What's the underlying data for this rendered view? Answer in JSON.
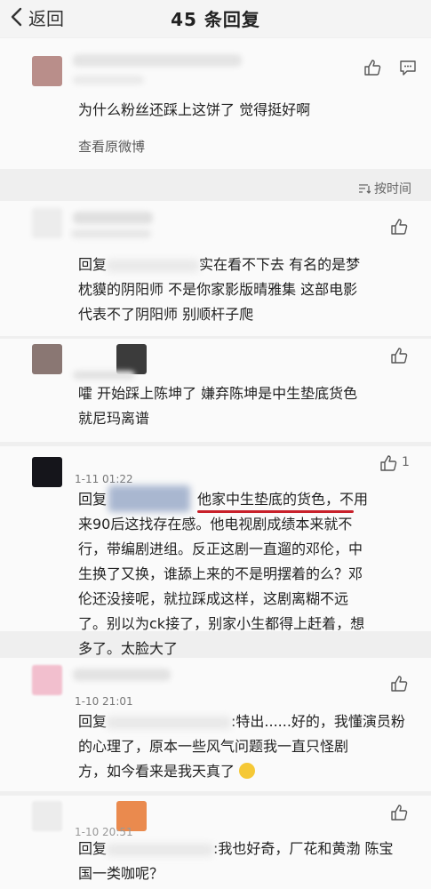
{
  "header": {
    "back_label": "返回",
    "title": "45 条回复"
  },
  "original": {
    "text": "为什么粉丝还踩上这饼了 觉得挺好啊",
    "view_original": "查看原微博"
  },
  "sort": {
    "label": "按时间"
  },
  "replies": [
    {
      "prefix": "回复",
      "line1": "实在看不下去 有名的是梦",
      "line2": "枕貘的阴阳师 不是你家影版晴雅集 这部电影",
      "line3": "代表不了阴阳师 别顺杆子爬"
    },
    {
      "line1": "嚯 开始踩上陈坤了 嫌弃陈坤是中生垫底货色",
      "line2": "就尼玛离谱"
    },
    {
      "time": "1-11 01:22",
      "likes": "1",
      "prefix": "回复",
      "highlight": "他家中生垫底的货色",
      "line1_rest": "，不用",
      "line2": "来90后这找存在感。他电视剧成绩本来就不",
      "line3": "行，带编剧进组。反正这剧一直遛的邓伦，中",
      "line4": "生换了又换，谁舔上来的不是明摆着的么？邓",
      "line5": "伦还没接呢，就拉踩成这样，这剧离糊不远",
      "line6": "了。别以为ck接了，别家小生都得上赶着，想",
      "line7": "多了。太脸大了"
    },
    {
      "time": "1-10 21:01",
      "prefix": "回复",
      "line1": ":特出......好的，我懂演员粉",
      "line2": "的心理了，原本一些风气问题我一直只怪剧",
      "line3": "方，如今看来是我天真了"
    },
    {
      "time": "1-10 20:51",
      "prefix": "回复",
      "line1": ":我也好奇，厂花和黄渤 陈宝",
      "line2": "国一类咖呢？"
    }
  ],
  "icons": {
    "like": "thumbs-up-icon",
    "comment": "comment-icon",
    "back": "chevron-left-icon",
    "sort": "sort-icon"
  },
  "colors": {
    "highlight_underline": "#c8202a"
  }
}
